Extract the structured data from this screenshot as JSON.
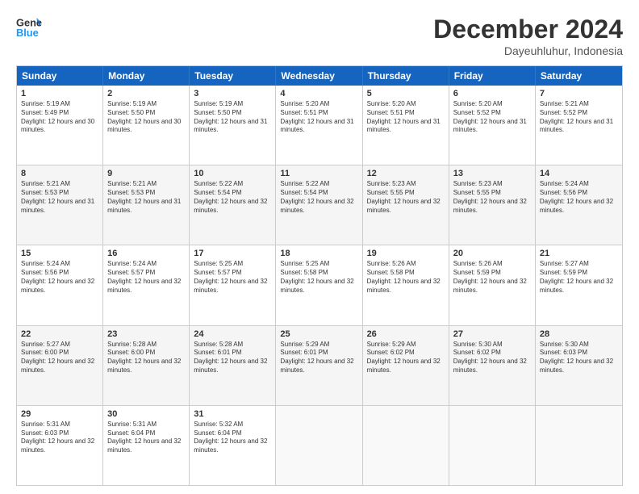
{
  "logo": {
    "line1": "General",
    "line2": "Blue"
  },
  "title": "December 2024",
  "location": "Dayeuhluhur, Indonesia",
  "days_of_week": [
    "Sunday",
    "Monday",
    "Tuesday",
    "Wednesday",
    "Thursday",
    "Friday",
    "Saturday"
  ],
  "rows": [
    [
      {
        "day": "",
        "empty": true
      },
      {
        "day": "2",
        "sunrise": "Sunrise: 5:19 AM",
        "sunset": "Sunset: 5:50 PM",
        "daylight": "Daylight: 12 hours and 30 minutes."
      },
      {
        "day": "3",
        "sunrise": "Sunrise: 5:19 AM",
        "sunset": "Sunset: 5:50 PM",
        "daylight": "Daylight: 12 hours and 31 minutes."
      },
      {
        "day": "4",
        "sunrise": "Sunrise: 5:20 AM",
        "sunset": "Sunset: 5:51 PM",
        "daylight": "Daylight: 12 hours and 31 minutes."
      },
      {
        "day": "5",
        "sunrise": "Sunrise: 5:20 AM",
        "sunset": "Sunset: 5:51 PM",
        "daylight": "Daylight: 12 hours and 31 minutes."
      },
      {
        "day": "6",
        "sunrise": "Sunrise: 5:20 AM",
        "sunset": "Sunset: 5:52 PM",
        "daylight": "Daylight: 12 hours and 31 minutes."
      },
      {
        "day": "7",
        "sunrise": "Sunrise: 5:21 AM",
        "sunset": "Sunset: 5:52 PM",
        "daylight": "Daylight: 12 hours and 31 minutes."
      }
    ],
    [
      {
        "day": "1",
        "sunrise": "Sunrise: 5:19 AM",
        "sunset": "Sunset: 5:49 PM",
        "daylight": "Daylight: 12 hours and 30 minutes."
      },
      {
        "day": "9",
        "sunrise": "Sunrise: 5:21 AM",
        "sunset": "Sunset: 5:53 PM",
        "daylight": "Daylight: 12 hours and 31 minutes."
      },
      {
        "day": "10",
        "sunrise": "Sunrise: 5:22 AM",
        "sunset": "Sunset: 5:54 PM",
        "daylight": "Daylight: 12 hours and 32 minutes."
      },
      {
        "day": "11",
        "sunrise": "Sunrise: 5:22 AM",
        "sunset": "Sunset: 5:54 PM",
        "daylight": "Daylight: 12 hours and 32 minutes."
      },
      {
        "day": "12",
        "sunrise": "Sunrise: 5:23 AM",
        "sunset": "Sunset: 5:55 PM",
        "daylight": "Daylight: 12 hours and 32 minutes."
      },
      {
        "day": "13",
        "sunrise": "Sunrise: 5:23 AM",
        "sunset": "Sunset: 5:55 PM",
        "daylight": "Daylight: 12 hours and 32 minutes."
      },
      {
        "day": "14",
        "sunrise": "Sunrise: 5:24 AM",
        "sunset": "Sunset: 5:56 PM",
        "daylight": "Daylight: 12 hours and 32 minutes."
      }
    ],
    [
      {
        "day": "8",
        "sunrise": "Sunrise: 5:21 AM",
        "sunset": "Sunset: 5:53 PM",
        "daylight": "Daylight: 12 hours and 31 minutes."
      },
      {
        "day": "16",
        "sunrise": "Sunrise: 5:24 AM",
        "sunset": "Sunset: 5:57 PM",
        "daylight": "Daylight: 12 hours and 32 minutes."
      },
      {
        "day": "17",
        "sunrise": "Sunrise: 5:25 AM",
        "sunset": "Sunset: 5:57 PM",
        "daylight": "Daylight: 12 hours and 32 minutes."
      },
      {
        "day": "18",
        "sunrise": "Sunrise: 5:25 AM",
        "sunset": "Sunset: 5:58 PM",
        "daylight": "Daylight: 12 hours and 32 minutes."
      },
      {
        "day": "19",
        "sunrise": "Sunrise: 5:26 AM",
        "sunset": "Sunset: 5:58 PM",
        "daylight": "Daylight: 12 hours and 32 minutes."
      },
      {
        "day": "20",
        "sunrise": "Sunrise: 5:26 AM",
        "sunset": "Sunset: 5:59 PM",
        "daylight": "Daylight: 12 hours and 32 minutes."
      },
      {
        "day": "21",
        "sunrise": "Sunrise: 5:27 AM",
        "sunset": "Sunset: 5:59 PM",
        "daylight": "Daylight: 12 hours and 32 minutes."
      }
    ],
    [
      {
        "day": "15",
        "sunrise": "Sunrise: 5:24 AM",
        "sunset": "Sunset: 5:56 PM",
        "daylight": "Daylight: 12 hours and 32 minutes."
      },
      {
        "day": "23",
        "sunrise": "Sunrise: 5:28 AM",
        "sunset": "Sunset: 6:00 PM",
        "daylight": "Daylight: 12 hours and 32 minutes."
      },
      {
        "day": "24",
        "sunrise": "Sunrise: 5:28 AM",
        "sunset": "Sunset: 6:01 PM",
        "daylight": "Daylight: 12 hours and 32 minutes."
      },
      {
        "day": "25",
        "sunrise": "Sunrise: 5:29 AM",
        "sunset": "Sunset: 6:01 PM",
        "daylight": "Daylight: 12 hours and 32 minutes."
      },
      {
        "day": "26",
        "sunrise": "Sunrise: 5:29 AM",
        "sunset": "Sunset: 6:02 PM",
        "daylight": "Daylight: 12 hours and 32 minutes."
      },
      {
        "day": "27",
        "sunrise": "Sunrise: 5:30 AM",
        "sunset": "Sunset: 6:02 PM",
        "daylight": "Daylight: 12 hours and 32 minutes."
      },
      {
        "day": "28",
        "sunrise": "Sunrise: 5:30 AM",
        "sunset": "Sunset: 6:03 PM",
        "daylight": "Daylight: 12 hours and 32 minutes."
      }
    ],
    [
      {
        "day": "22",
        "sunrise": "Sunrise: 5:27 AM",
        "sunset": "Sunset: 6:00 PM",
        "daylight": "Daylight: 12 hours and 32 minutes."
      },
      {
        "day": "30",
        "sunrise": "Sunrise: 5:31 AM",
        "sunset": "Sunset: 6:04 PM",
        "daylight": "Daylight: 12 hours and 32 minutes."
      },
      {
        "day": "31",
        "sunrise": "Sunrise: 5:32 AM",
        "sunset": "Sunset: 6:04 PM",
        "daylight": "Daylight: 12 hours and 32 minutes."
      },
      {
        "day": "",
        "empty": true
      },
      {
        "day": "",
        "empty": true
      },
      {
        "day": "",
        "empty": true
      },
      {
        "day": "",
        "empty": true
      }
    ],
    [
      {
        "day": "29",
        "sunrise": "Sunrise: 5:31 AM",
        "sunset": "Sunset: 6:03 PM",
        "daylight": "Daylight: 12 hours and 32 minutes."
      },
      {
        "day": "",
        "empty": true
      },
      {
        "day": "",
        "empty": true
      },
      {
        "day": "",
        "empty": true
      },
      {
        "day": "",
        "empty": true
      },
      {
        "day": "",
        "empty": true
      },
      {
        "day": "",
        "empty": true
      }
    ]
  ]
}
